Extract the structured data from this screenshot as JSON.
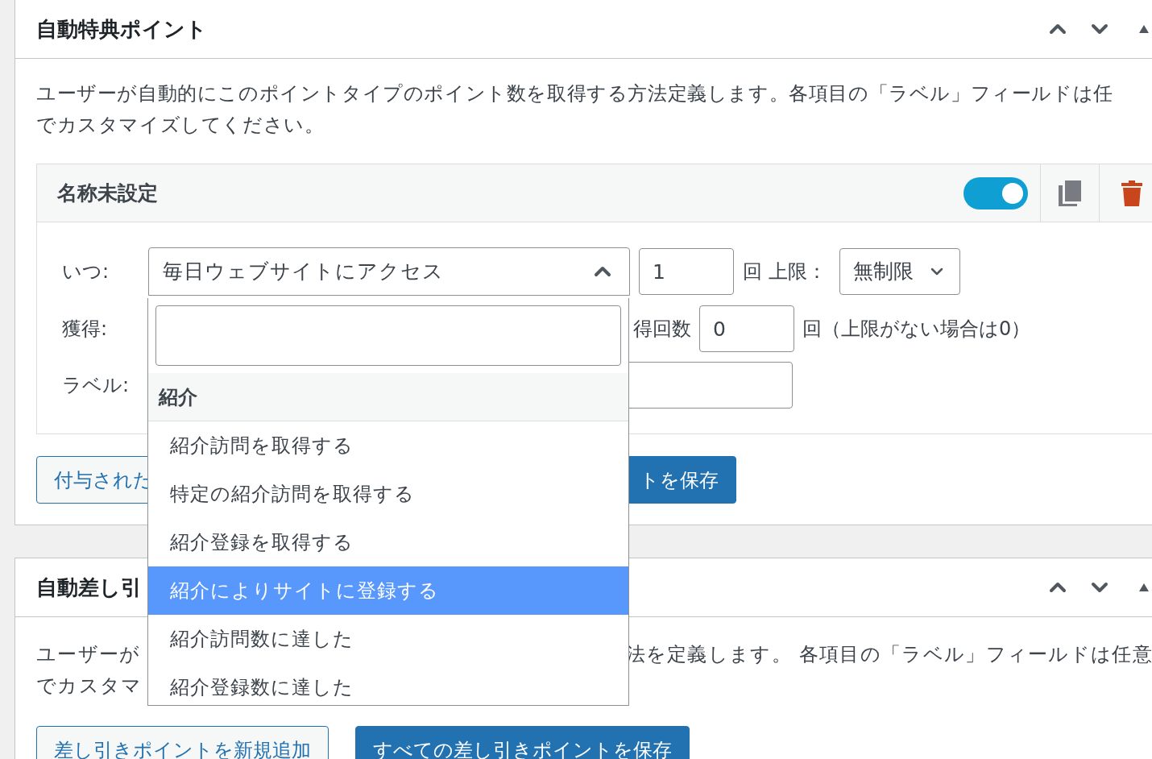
{
  "panels": [
    {
      "title": "自動特典ポイント",
      "description": [
        "ユーザーが自動的にこのポイントタイプのポイント数を取得する方法定義します。各項目の「ラベル」フィールドは任",
        "でカスタマイズしてください。"
      ],
      "item": {
        "title": "名称未設定",
        "enabled": true,
        "when_label": "いつ:",
        "when_value": "毎日ウェブサイトにアクセス",
        "when_expanded": true,
        "count_value": "1",
        "count_unit": "回 上限：",
        "limit_value": "無制限",
        "earn_label": "獲得:",
        "earn_count_label": "得回数",
        "earn_count_value": "0",
        "earn_count_note": "回（上限がない場合は0）",
        "label_label": "ラベル:"
      },
      "buttons": [
        {
          "label": "付与された",
          "kind": "secondary"
        },
        {
          "label": "トを保存",
          "kind": "primary"
        }
      ]
    },
    {
      "title": "自動差し引",
      "description_left": [
        "ユーザーが",
        "でカスタマ"
      ],
      "description_right": "法を定義します。 各項目の「ラベル」フィールドは任意",
      "buttons": [
        {
          "label": "差し引きポイントを新規追加",
          "kind": "secondary"
        },
        {
          "label": "すべての差し引きポイントを保存",
          "kind": "primary"
        }
      ]
    }
  ],
  "dropdown": {
    "group": "紹介",
    "options": [
      {
        "label": "紹介訪問を取得する",
        "selected": false
      },
      {
        "label": "特定の紹介訪問を取得する",
        "selected": false
      },
      {
        "label": "紹介登録を取得する",
        "selected": false
      },
      {
        "label": "紹介によりサイトに登録する",
        "selected": true
      },
      {
        "label": "紹介訪問数に達した",
        "selected": false
      },
      {
        "label": "紹介登録数に達した",
        "selected": false
      }
    ]
  }
}
